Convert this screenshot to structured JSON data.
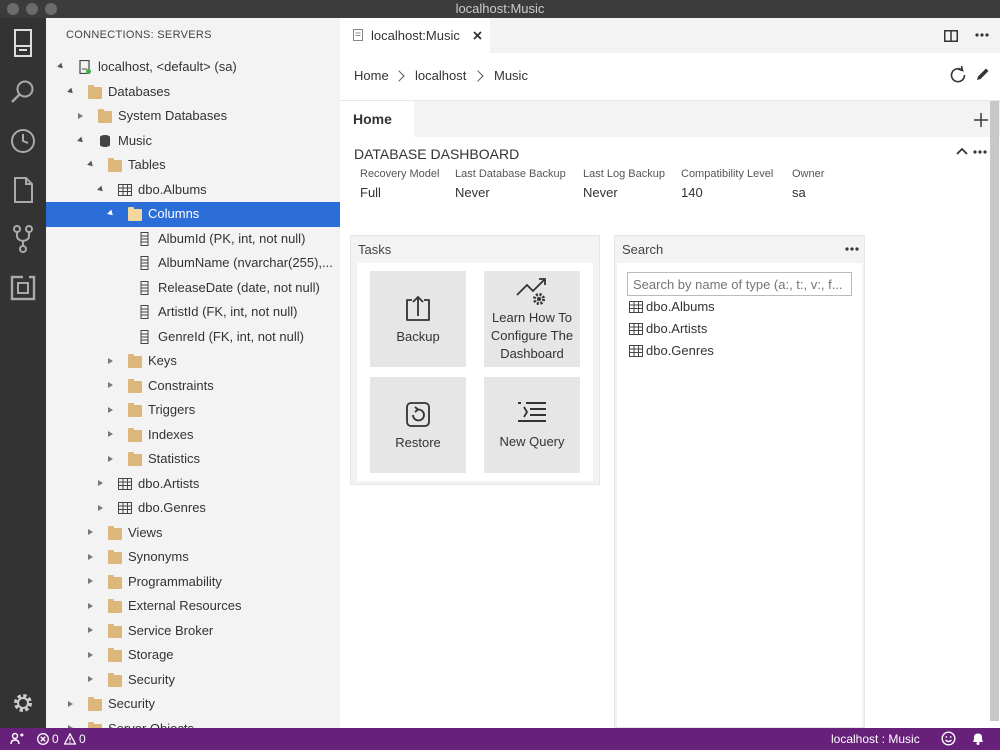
{
  "window": {
    "title": "localhost:Music"
  },
  "activity_bar": {
    "icons": [
      "servers-icon",
      "search-icon",
      "history-icon",
      "file-icon",
      "source-control-icon",
      "extensions-icon",
      "settings-icon"
    ]
  },
  "sidebar": {
    "title": "CONNECTIONS: SERVERS",
    "tree": [
      {
        "label": "localhost, <default> (sa)",
        "level": 0,
        "state": "open",
        "icon": "server-icon"
      },
      {
        "label": "Databases",
        "level": 1,
        "state": "open",
        "icon": "folder-icon"
      },
      {
        "label": "System Databases",
        "level": 2,
        "state": "closed",
        "icon": "folder-icon"
      },
      {
        "label": "Music",
        "level": 2,
        "state": "open",
        "icon": "database-icon"
      },
      {
        "label": "Tables",
        "level": 3,
        "state": "open",
        "icon": "folder-icon"
      },
      {
        "label": "dbo.Albums",
        "level": 4,
        "state": "open",
        "icon": "table-icon"
      },
      {
        "label": "Columns",
        "level": 5,
        "state": "open",
        "icon": "folder-icon",
        "selected": true
      },
      {
        "label": "AlbumId (PK, int, not null)",
        "level": 6,
        "state": "none",
        "icon": "column-icon"
      },
      {
        "label": "AlbumName (nvarchar(255),...",
        "level": 6,
        "state": "none",
        "icon": "column-icon"
      },
      {
        "label": "ReleaseDate (date, not null)",
        "level": 6,
        "state": "none",
        "icon": "column-icon"
      },
      {
        "label": "ArtistId (FK, int, not null)",
        "level": 6,
        "state": "none",
        "icon": "column-icon"
      },
      {
        "label": "GenreId (FK, int, not null)",
        "level": 6,
        "state": "none",
        "icon": "column-icon"
      },
      {
        "label": "Keys",
        "level": 5,
        "state": "closed",
        "icon": "folder-icon"
      },
      {
        "label": "Constraints",
        "level": 5,
        "state": "closed",
        "icon": "folder-icon"
      },
      {
        "label": "Triggers",
        "level": 5,
        "state": "closed",
        "icon": "folder-icon"
      },
      {
        "label": "Indexes",
        "level": 5,
        "state": "closed",
        "icon": "folder-icon"
      },
      {
        "label": "Statistics",
        "level": 5,
        "state": "closed",
        "icon": "folder-icon"
      },
      {
        "label": "dbo.Artists",
        "level": 4,
        "state": "closed",
        "icon": "table-icon"
      },
      {
        "label": "dbo.Genres",
        "level": 4,
        "state": "closed",
        "icon": "table-icon"
      },
      {
        "label": "Views",
        "level": 3,
        "state": "closed",
        "icon": "folder-icon"
      },
      {
        "label": "Synonyms",
        "level": 3,
        "state": "closed",
        "icon": "folder-icon"
      },
      {
        "label": "Programmability",
        "level": 3,
        "state": "closed",
        "icon": "folder-icon"
      },
      {
        "label": "External Resources",
        "level": 3,
        "state": "closed",
        "icon": "folder-icon"
      },
      {
        "label": "Service Broker",
        "level": 3,
        "state": "closed",
        "icon": "folder-icon"
      },
      {
        "label": "Storage",
        "level": 3,
        "state": "closed",
        "icon": "folder-icon"
      },
      {
        "label": "Security",
        "level": 3,
        "state": "closed",
        "icon": "folder-icon"
      },
      {
        "label": "Security",
        "level": 1,
        "state": "closed",
        "icon": "folder-icon"
      },
      {
        "label": "Server Objects",
        "level": 1,
        "state": "closed",
        "icon": "folder-icon"
      }
    ]
  },
  "editor": {
    "tab_label": "localhost:Music",
    "breadcrumb": [
      "Home",
      "localhost",
      "Music"
    ],
    "home_tab": "Home",
    "dashboard_title": "DATABASE DASHBOARD",
    "properties": [
      {
        "label": "Recovery Model",
        "value": "Full"
      },
      {
        "label": "Last Database Backup",
        "value": "Never"
      },
      {
        "label": "Last Log Backup",
        "value": "Never"
      },
      {
        "label": "Compatibility Level",
        "value": "140"
      },
      {
        "label": "Owner",
        "value": "sa"
      }
    ],
    "tasks": {
      "title": "Tasks",
      "items": [
        {
          "label": "Backup",
          "icon": "backup-icon"
        },
        {
          "label": "Learn How To Configure The Dashboard",
          "icon": "configure-icon"
        },
        {
          "label": "Restore",
          "icon": "restore-icon"
        },
        {
          "label": "New Query",
          "icon": "new-query-icon"
        }
      ]
    },
    "search": {
      "title": "Search",
      "placeholder": "Search by name of type (a:, t:, v:, f...",
      "results": [
        "dbo.Albums",
        "dbo.Artists",
        "dbo.Genres"
      ]
    }
  },
  "status_bar": {
    "errors": "0",
    "warnings": "0",
    "connection": "localhost : Music"
  }
}
